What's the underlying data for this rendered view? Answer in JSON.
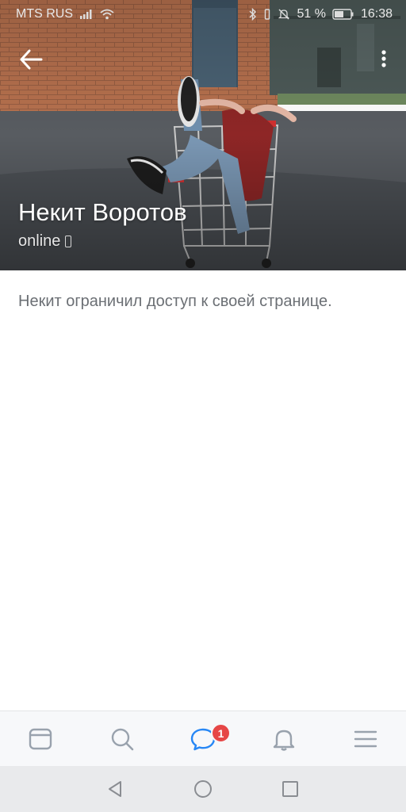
{
  "status_bar": {
    "carrier": "MTS RUS",
    "battery_percent": "51 %",
    "time": "16:38",
    "icons": [
      "signal-icon",
      "wifi-icon",
      "bluetooth-icon",
      "vibrate-icon",
      "mute-icon",
      "battery-icon"
    ]
  },
  "header": {
    "back_icon": "back-arrow-icon",
    "menu_icon": "more-vertical-icon"
  },
  "profile": {
    "name": "Некит Воротов",
    "status": "online",
    "status_icon": "mobile-phone-icon",
    "message": "Некит ограничил доступ к своей странице."
  },
  "tab_bar": {
    "tabs": [
      {
        "icon": "news-icon"
      },
      {
        "icon": "search-icon"
      },
      {
        "icon": "messages-icon",
        "badge": "1"
      },
      {
        "icon": "notifications-bell-icon"
      },
      {
        "icon": "menu-icon"
      }
    ],
    "badge_color": "#e64646"
  },
  "nav_bar": {
    "buttons": [
      "back-triangle-icon",
      "home-circle-icon",
      "recents-square-icon"
    ]
  }
}
